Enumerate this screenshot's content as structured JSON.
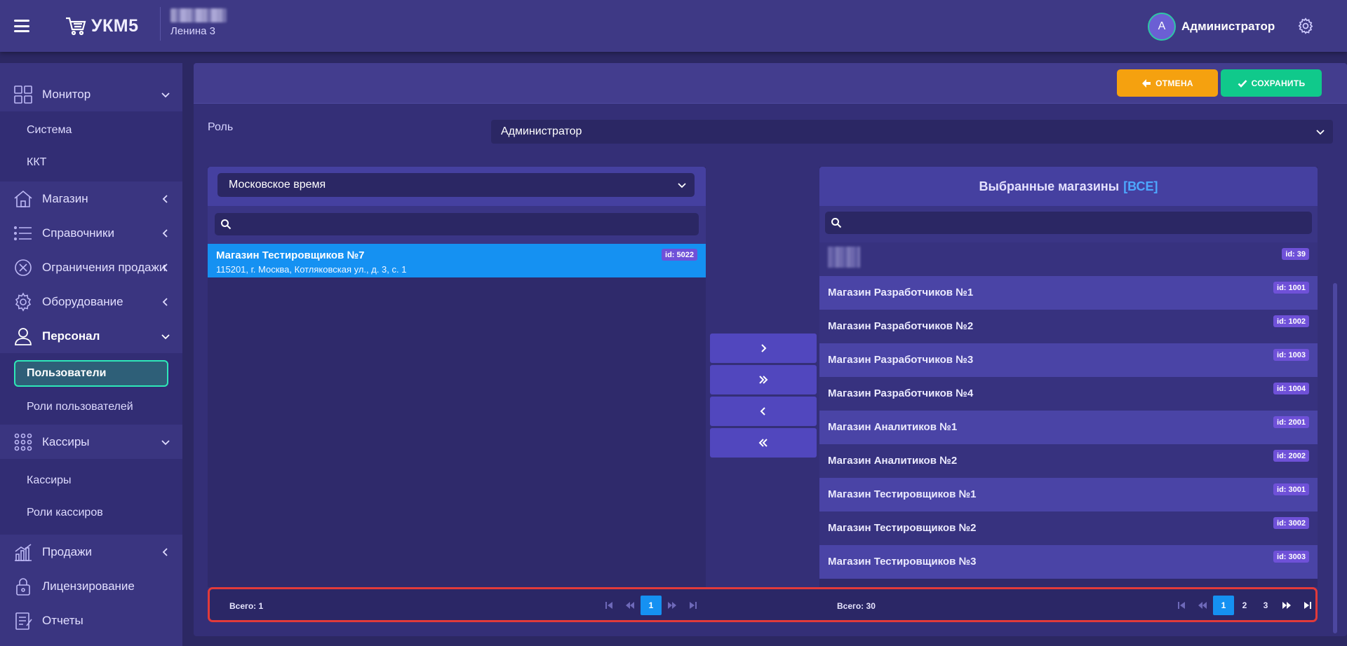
{
  "header": {
    "logo_text": "УКМ5",
    "store_name": "Ленина 3",
    "user_initial": "A",
    "user_name": "Администратор"
  },
  "sidebar": {
    "items": [
      {
        "label": "Монитор",
        "icon": "monitor-icon"
      },
      {
        "label": "Магазин",
        "icon": "store-icon"
      },
      {
        "label": "Справочники",
        "icon": "list-icon"
      },
      {
        "label": "Ограничения продажи",
        "icon": "restriction-icon"
      },
      {
        "label": "Оборудование",
        "icon": "equipment-icon"
      },
      {
        "label": "Персонал",
        "icon": "person-icon"
      },
      {
        "label": "Кассиры",
        "icon": "cashiers-icon"
      },
      {
        "label": "Продажи",
        "icon": "sales-icon"
      },
      {
        "label": "Лицензирование",
        "icon": "lock-icon"
      },
      {
        "label": "Отчеты",
        "icon": "reports-icon"
      }
    ],
    "monitor_sub": [
      "Система",
      "ККТ"
    ],
    "personnel_sub": [
      "Пользователи",
      "Роли пользователей"
    ],
    "cashiers_sub": [
      "Кассиры",
      "Роли кассиров"
    ]
  },
  "toolbar": {
    "cancel_label": "ОТМЕНА",
    "save_label": "СОХРАНИТЬ"
  },
  "role": {
    "label": "Роль",
    "value": "Администратор"
  },
  "left_panel": {
    "timezone": "Московское время",
    "search_placeholder": "",
    "selected_store": {
      "name": "Магазин Тестировщиков №7",
      "address": "115201, г. Москва, Котляковская ул., д. 3, с. 1",
      "id": "id: 5022"
    },
    "total": "Всего: 1",
    "pages": [
      "1"
    ]
  },
  "right_panel": {
    "title": "Выбранные магазины",
    "all_link": "[ВСЕ]",
    "search_placeholder": "",
    "stores": [
      {
        "name": "",
        "id": "id: 39"
      },
      {
        "name": "Магазин Разработчиков №1",
        "id": "id: 1001"
      },
      {
        "name": "Магазин Разработчиков №2",
        "id": "id: 1002"
      },
      {
        "name": "Магазин Разработчиков №3",
        "id": "id: 1003"
      },
      {
        "name": "Магазин Разработчиков №4",
        "id": "id: 1004"
      },
      {
        "name": "Магазин Аналитиков №1",
        "id": "id: 2001"
      },
      {
        "name": "Магазин Аналитиков №2",
        "id": "id: 2002"
      },
      {
        "name": "Магазин Тестировщиков №1",
        "id": "id: 3001"
      },
      {
        "name": "Магазин Тестировщиков №2",
        "id": "id: 3002"
      },
      {
        "name": "Магазин Тестировщиков №3",
        "id": "id: 3003"
      }
    ],
    "total": "Всего: 30",
    "pages": [
      "1",
      "2",
      "3"
    ]
  },
  "colors": {
    "accent_blue": "#1591f2",
    "cancel": "#f5a10f",
    "save": "#10c98b",
    "active_border": "#2ee8b8"
  }
}
